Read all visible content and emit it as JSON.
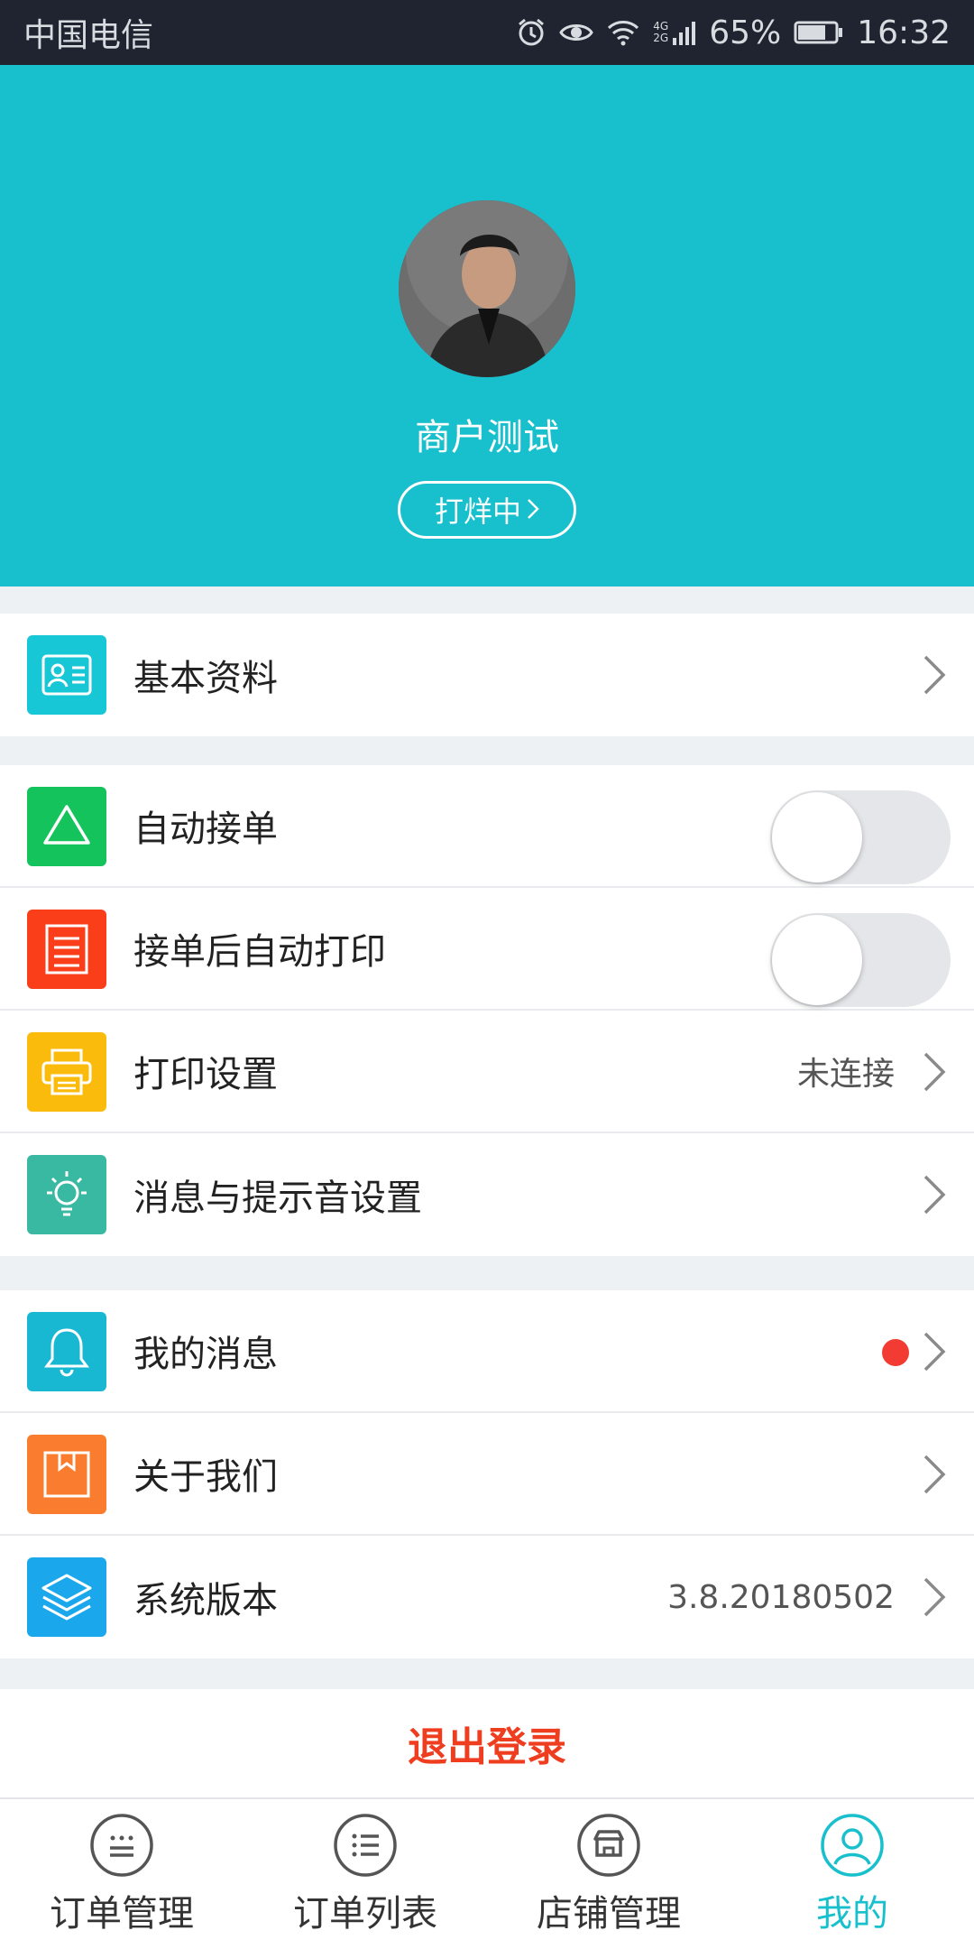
{
  "status_bar": {
    "carrier": "中国电信",
    "network": "4G 2G",
    "battery": "65%",
    "time": "16:32",
    "icons": [
      "alarm-icon",
      "eye-icon",
      "wifi-icon",
      "signal-icon",
      "battery-icon"
    ]
  },
  "profile": {
    "merchant_name": "商户测试",
    "status_label": "打烊中"
  },
  "sections": {
    "basic": {
      "label": "基本资料",
      "icon": "id-card-icon",
      "color": "#18c7d6"
    },
    "auto_accept": {
      "label": "自动接单",
      "icon": "triangle-icon",
      "color": "#14c35c",
      "enabled": false
    },
    "auto_print": {
      "label": "接单后自动打印",
      "icon": "receipt-icon",
      "color": "#fa3e1a",
      "enabled": false
    },
    "print_settings": {
      "label": "打印设置",
      "value": "未连接",
      "icon": "printer-icon",
      "color": "#fbbb0c"
    },
    "notifications": {
      "label": "消息与提示音设置",
      "icon": "lightbulb-icon",
      "color": "#3ab9a2"
    },
    "my_messages": {
      "label": "我的消息",
      "icon": "bell-icon",
      "color": "#19b8d2",
      "unread": true
    },
    "about": {
      "label": "关于我们",
      "icon": "box-icon",
      "color": "#fa7c2e"
    },
    "version": {
      "label": "系统版本",
      "value": "3.8.20180502",
      "icon": "layers-icon",
      "color": "#1aa7ec"
    }
  },
  "logout_label": "退出登录",
  "tabs": [
    {
      "label": "订单管理",
      "icon": "order-manage-icon"
    },
    {
      "label": "订单列表",
      "icon": "order-list-icon"
    },
    {
      "label": "店铺管理",
      "icon": "store-icon"
    },
    {
      "label": "我的",
      "icon": "user-icon",
      "active": true
    }
  ],
  "colors": {
    "accent": "#17c0cc",
    "logout": "#ef3d1f",
    "badge": "#f23c33"
  }
}
